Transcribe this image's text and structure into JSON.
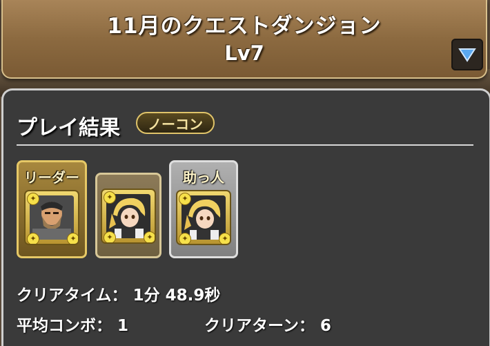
{
  "header": {
    "title": "11月のクエストダンジョン",
    "level": "Lv7",
    "dropdown_icon": "triangle-down-icon"
  },
  "result": {
    "heading": "プレイ結果",
    "badge": "ノーコン",
    "team": {
      "leader_label": "リーダー",
      "helper_label": "助っ人"
    },
    "stats": {
      "clear_time_label": "クリアタイム：",
      "clear_time_value": "1分 48.9秒",
      "avg_combo_label": "平均コンボ：",
      "avg_combo_value": "1",
      "clear_turn_label": "クリアターン：",
      "clear_turn_value": "6"
    }
  },
  "colors": {
    "header_bg": "#8c6a40",
    "panel_bg": "#3a3a3a",
    "leader_frame": "#e6c866",
    "helper_frame": "#b0b0b0",
    "badge_border": "#e0c46a"
  }
}
